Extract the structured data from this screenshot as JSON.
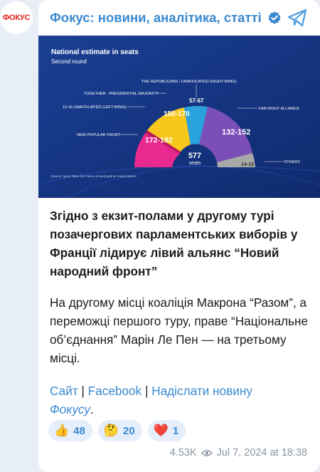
{
  "avatar": {
    "text": "ФОКУС",
    "color": "#e2231a"
  },
  "header": {
    "channel_name": "Фокус: новини, аналітика, статті",
    "verified_icon": "verified-badge-icon",
    "share_icon": "telegram-share-icon"
  },
  "image": {
    "title": "National estimate in seats",
    "subtitle": "Second round",
    "total_seats": "577",
    "total_label": "seats",
    "source": "Source: Ipsos Talan for France 24 and partner organizations",
    "label_republicans": "THE REPUBLICANS / UNAFFILIATED (RIGHT-WING)",
    "label_together": "TOGETHER - PRESIDENTIAL MAJORITY",
    "label_unaffiliated_left": "13-16 UNAFFILIATED (LEFT-WING)",
    "label_nfp": "NEW POPULAR FRONT",
    "label_far_right": "FAR RIGHT ALLIANCE",
    "label_others": "OTHERS",
    "seg_nfp": "172-192",
    "seg_together": "150-170",
    "seg_republicans": "57-67",
    "seg_far_right": "132-152",
    "seg_others": "14-19",
    "colors": {
      "nfp": "#e8298f",
      "together": "#f8c71c",
      "republicans": "#2aa3dc",
      "far_right": "#7c4fb8",
      "others": "#a8a8a8",
      "left_unaffiliated": "#c2185b"
    }
  },
  "post": {
    "headline": "Згідно з екзит-полами у другому турі позачергових парламентських виборів у Франції лідирує лівий альянс “Новий народний фронт”",
    "paragraph": "На другому місці коаліція Макрона “Разом”, а переможці першого туру, праве “Національне об’єднання” Марін Ле Пен — на третьому місці.",
    "link_site": "Сайт",
    "link_facebook": "Facebook",
    "link_send_a": "Надіслати новину",
    "link_send_b": "Фокусу",
    "separator": "|",
    "period": "."
  },
  "reactions": [
    {
      "emoji": "👍",
      "icon": "thumbs-up-icon",
      "count": "48"
    },
    {
      "emoji": "🤔",
      "icon": "thinking-face-icon",
      "count": "20"
    },
    {
      "emoji": "❤️",
      "icon": "red-heart-icon",
      "count": "1"
    }
  ],
  "meta": {
    "views": "4.53K",
    "views_icon": "eye-icon",
    "timestamp": "Jul 7, 2024 at 18:38"
  }
}
